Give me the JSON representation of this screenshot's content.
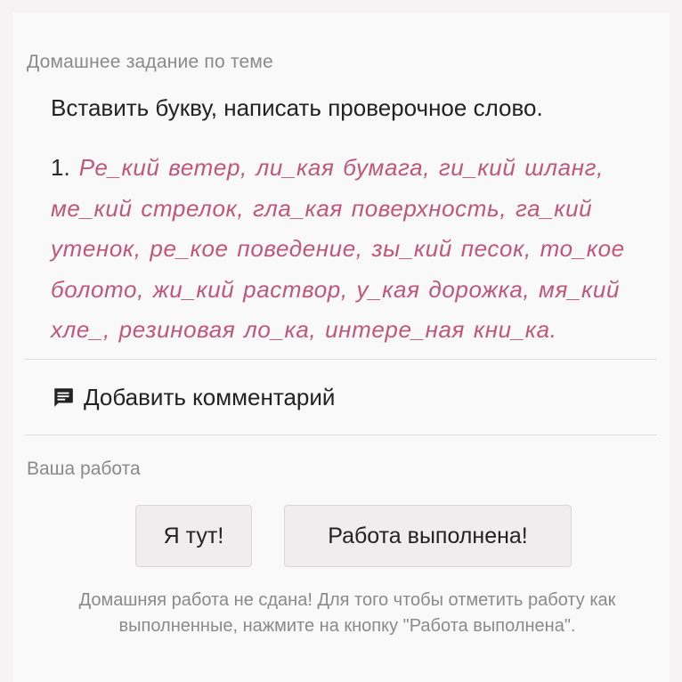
{
  "homework": {
    "section_title": "Домашнее задание по теме",
    "task_title": "Вставить букву, написать проверочное слово.",
    "task_number": "1.",
    "task_text": "Ре_кий ветер, ли_кая бумага, ги_кий шланг, ме_кий стрелок, гла_кая поверхность, га_кий утенок, ре_кое поведение, зы_кий песок, то_кое болото, жи_кий раствор, у_кая дорожка, мя_кий хле_, резиновая ло_ка, интере_ная кни_ка."
  },
  "comment": {
    "icon": "comment-icon",
    "label": "Добавить комментарий"
  },
  "work": {
    "section_title": "Ваша работа",
    "here_button": "Я тут!",
    "done_button": "Работа выполнена!",
    "notice": "Домашняя работа не сдана! Для того чтобы отметить работу как выполненные, нажмите на кнопку \"Работа выполнена\"."
  },
  "colors": {
    "accent_text": "#c0577a",
    "muted_text": "#8a8a8a",
    "button_bg": "#efedee"
  }
}
